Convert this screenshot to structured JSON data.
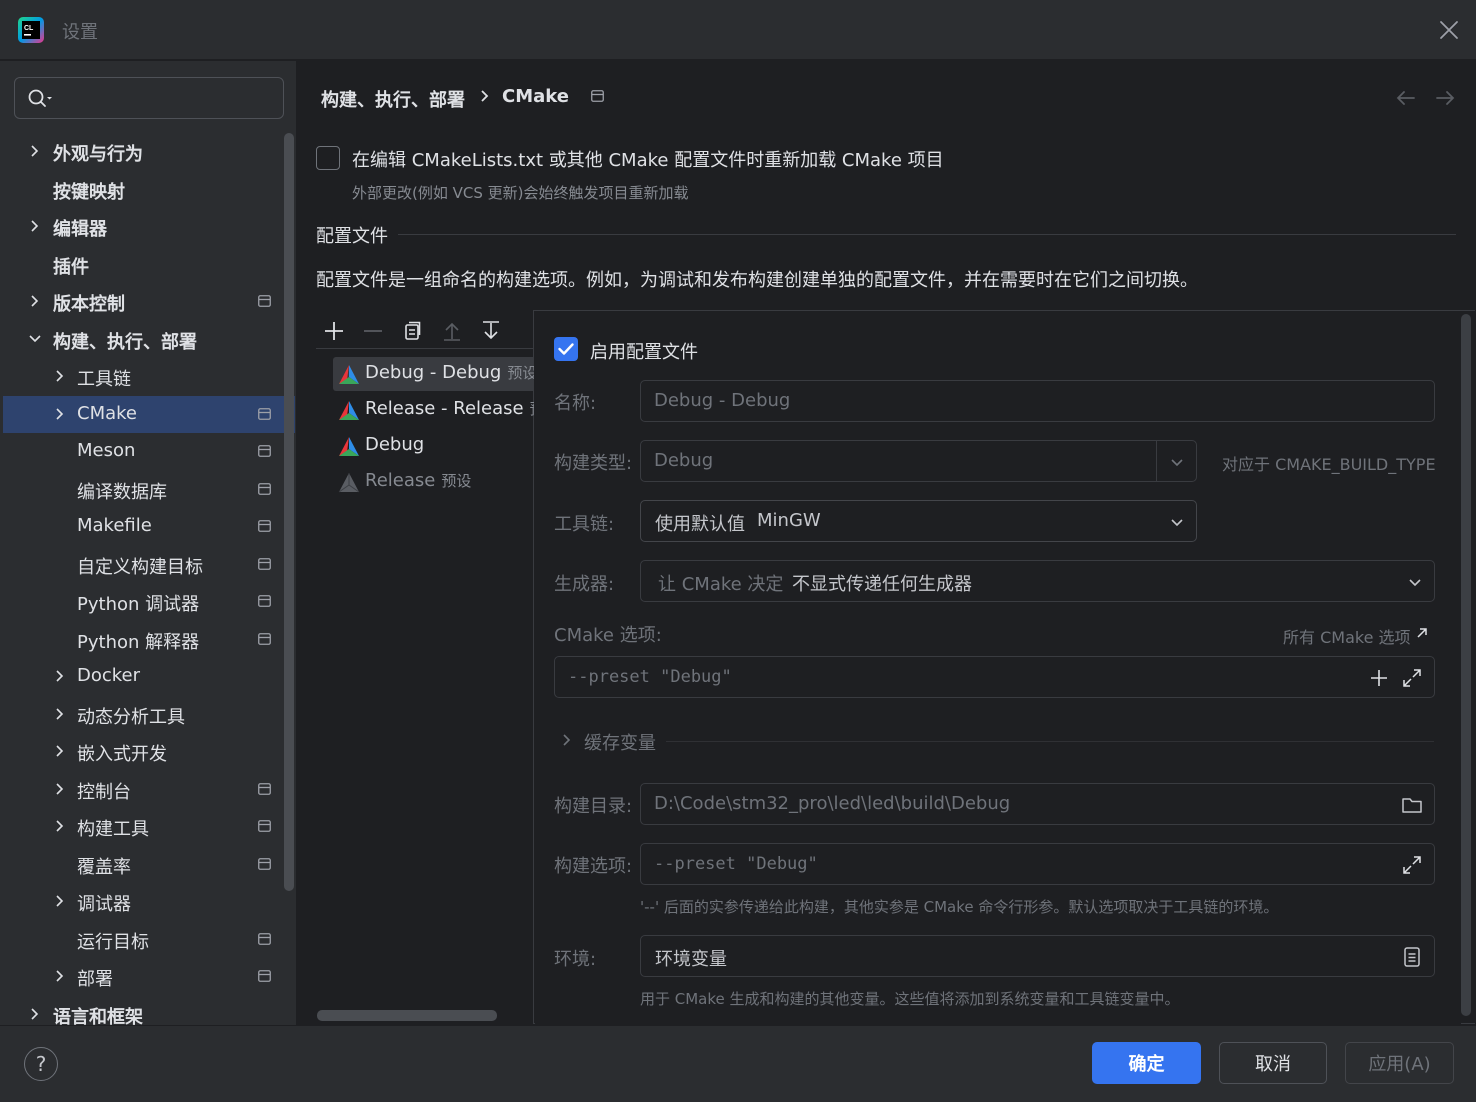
{
  "window": {
    "title": "设置"
  },
  "search": {
    "placeholder": ""
  },
  "sidebar": {
    "items": [
      {
        "label": "外观与行为"
      },
      {
        "label": "按键映射"
      },
      {
        "label": "编辑器"
      },
      {
        "label": "插件"
      },
      {
        "label": "版本控制"
      },
      {
        "label": "构建、执行、部署"
      },
      {
        "label": "工具链"
      },
      {
        "label": "CMake"
      },
      {
        "label": "Meson"
      },
      {
        "label": "编译数据库"
      },
      {
        "label": "Makefile"
      },
      {
        "label": "自定义构建目标"
      },
      {
        "label": "Python 调试器"
      },
      {
        "label": "Python 解释器"
      },
      {
        "label": "Docker"
      },
      {
        "label": "动态分析工具"
      },
      {
        "label": "嵌入式开发"
      },
      {
        "label": "控制台"
      },
      {
        "label": "构建工具"
      },
      {
        "label": "覆盖率"
      },
      {
        "label": "调试器"
      },
      {
        "label": "运行目标"
      },
      {
        "label": "部署"
      },
      {
        "label": "语言和框架"
      }
    ]
  },
  "breadcrumb": {
    "parent": "构建、执行、部署",
    "current": "CMake"
  },
  "reload": {
    "label": "在编辑 CMakeLists.txt 或其他 CMake 配置文件时重新加载 CMake 项目",
    "hint": "外部更改(例如 VCS 更新)会始终触发项目重新加载",
    "checked": false
  },
  "profiles_section": {
    "title": "配置文件",
    "description": "配置文件是一组命名的构建选项。例如，为调试和发布构建创建单独的配置文件，并在需要时在它们之间切换。"
  },
  "profiles": [
    {
      "name": "Debug - Debug",
      "tag": "预设"
    },
    {
      "name": "Release - Release",
      "tag": "预设"
    },
    {
      "name": "Debug",
      "tag": ""
    },
    {
      "name": "Release",
      "tag": "预设"
    }
  ],
  "detail": {
    "enable_label": "启用配置文件",
    "enabled": true,
    "name_label": "名称:",
    "name_value": "Debug - Debug",
    "build_type_label": "构建类型:",
    "build_type_value": "Debug",
    "build_type_hint": "对应于 CMAKE_BUILD_TYPE",
    "toolchain_label": "工具链:",
    "toolchain_value": "使用默认值",
    "toolchain_detail": "MinGW",
    "generator_label": "生成器:",
    "generator_value": "让 CMake 决定",
    "generator_detail": "不显式传递任何生成器",
    "cmake_options_label": "CMake 选项:",
    "cmake_options_link": "所有 CMake 选项",
    "cmake_options_value": "--preset \"Debug\"",
    "cache_label": "缓存变量",
    "build_dir_label": "构建目录:",
    "build_dir_value": "D:\\Code\\stm32_pro\\led\\led\\build\\Debug",
    "build_options_label": "构建选项:",
    "build_options_value": "--preset \"Debug\"",
    "build_options_hint": "'--' 后面的实参传递给此构建，其他实参是 CMake 命令行形参。默认选项取决于工具链的环境。",
    "env_label": "环境:",
    "env_value": "环境变量",
    "env_hint": "用于 CMake 生成和构建的其他变量。这些值将添加到系统变量和工具链变量中。"
  },
  "footer": {
    "help": "?",
    "ok": "确定",
    "cancel": "取消",
    "apply": "应用(A)"
  },
  "colors": {
    "accent": "#3574f0",
    "selection": "#2e436e",
    "background": "#1e1f22",
    "panel": "#2b2d30"
  }
}
